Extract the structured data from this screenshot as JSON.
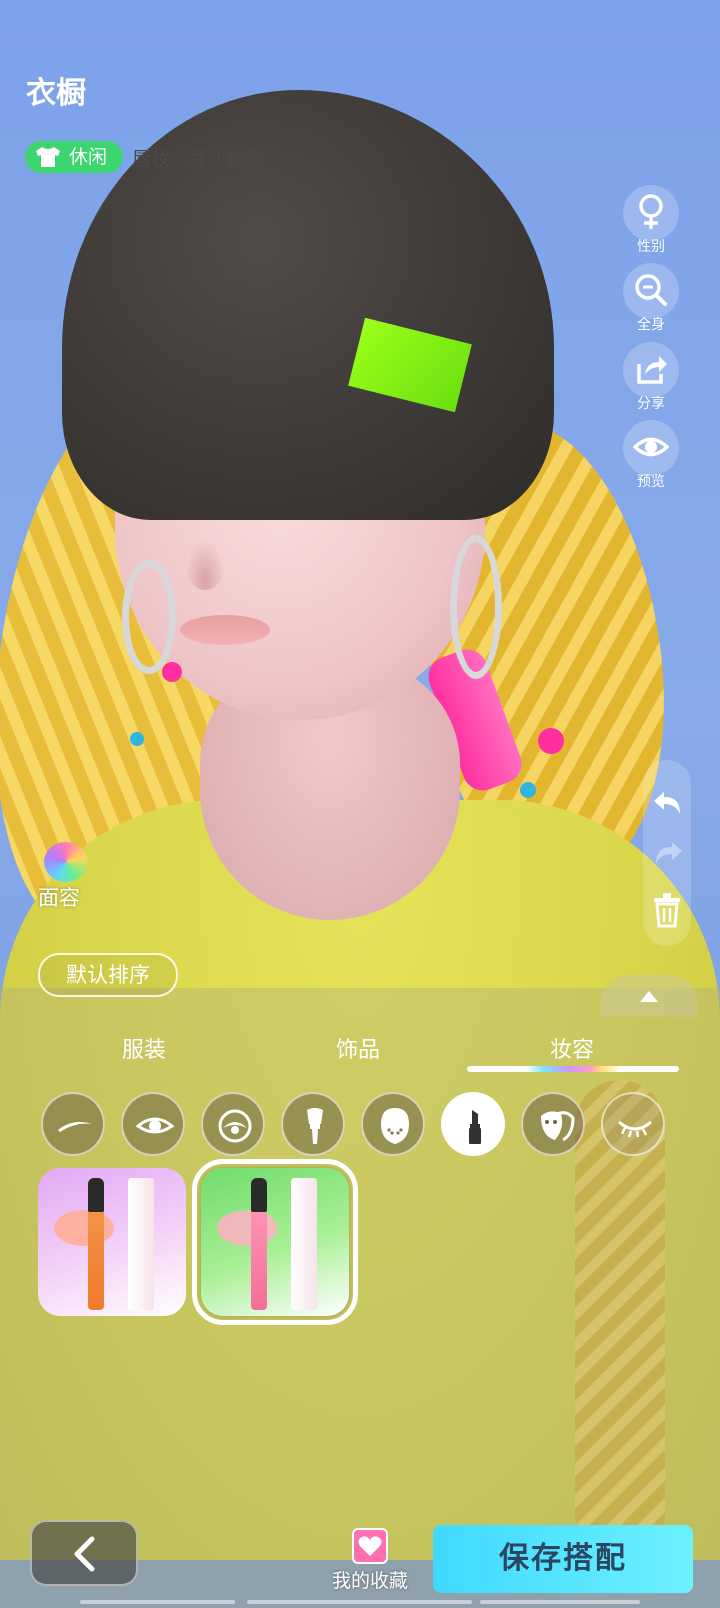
{
  "header": {
    "title": "衣橱",
    "style_tag": "休闲",
    "subtitle": "唇妆 · 豆沙粉嫩"
  },
  "side_actions": [
    {
      "label": "性别",
      "icon": "gender-female-icon"
    },
    {
      "label": "全身",
      "icon": "zoom-out-icon"
    },
    {
      "label": "分享",
      "icon": "share-icon"
    },
    {
      "label": "预览",
      "icon": "eye-icon"
    }
  ],
  "face_button": {
    "label": "面容",
    "icon": "face-paint-icon"
  },
  "sort_button": {
    "label": "默认排序"
  },
  "tabs": [
    {
      "label": "服装"
    },
    {
      "label": "饰品"
    },
    {
      "label": "妆容",
      "selected": true
    }
  ],
  "makeup_categories": [
    {
      "icon": "eyebrow-icon"
    },
    {
      "icon": "eye-makeup-icon"
    },
    {
      "icon": "eyeshadow-icon"
    },
    {
      "icon": "blush-brush-icon"
    },
    {
      "icon": "face-freckles-icon"
    },
    {
      "icon": "lipstick-icon",
      "selected": true
    },
    {
      "icon": "face-mask-icon"
    },
    {
      "icon": "eyelashes-icon"
    }
  ],
  "products": [
    {
      "name": "lipstick-coral",
      "bg": "#e7b6f2",
      "stick": "#f2843a",
      "smear": "#ffb39a"
    },
    {
      "name": "lipstick-pink",
      "bg": "#7fe07a",
      "stick": "#ff8fb0",
      "smear": "#ffb1c4",
      "selected": true
    }
  ],
  "bottom": {
    "favorites_label": "我的收藏",
    "save_label": "保存搭配"
  },
  "colors": {
    "tag_green": "#3dd56f",
    "save_cyan": "#3fd9ff",
    "fav_pink": "#ff6fb1"
  }
}
